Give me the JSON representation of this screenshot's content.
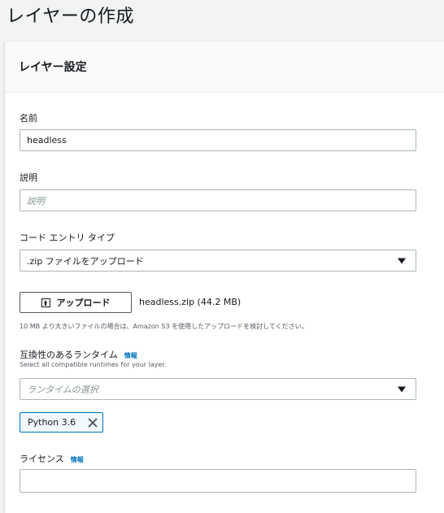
{
  "page": {
    "title": "レイヤーの作成"
  },
  "panel": {
    "title": "レイヤー設定"
  },
  "name": {
    "label": "名前",
    "value": "headless"
  },
  "description": {
    "label": "説明",
    "placeholder": "説明"
  },
  "code_entry": {
    "label": "コード エントリ タイプ",
    "value": ".zip ファイルをアップロード"
  },
  "upload": {
    "button_label": "アップロード",
    "file_name": "headless.zip (44.2 MB)",
    "hint": "10 MB より大きいファイルの場合は、Amazon S3 を使用したアップロードを検討してください。"
  },
  "runtimes": {
    "label": "互換性のあるランタイム",
    "info": "情報",
    "description": "Select all compatible runtimes for your layer.",
    "placeholder": "ランタイムの選択",
    "selected": [
      "Python 3.6"
    ]
  },
  "license": {
    "label": "ライセンス",
    "info": "情報",
    "value": ""
  }
}
